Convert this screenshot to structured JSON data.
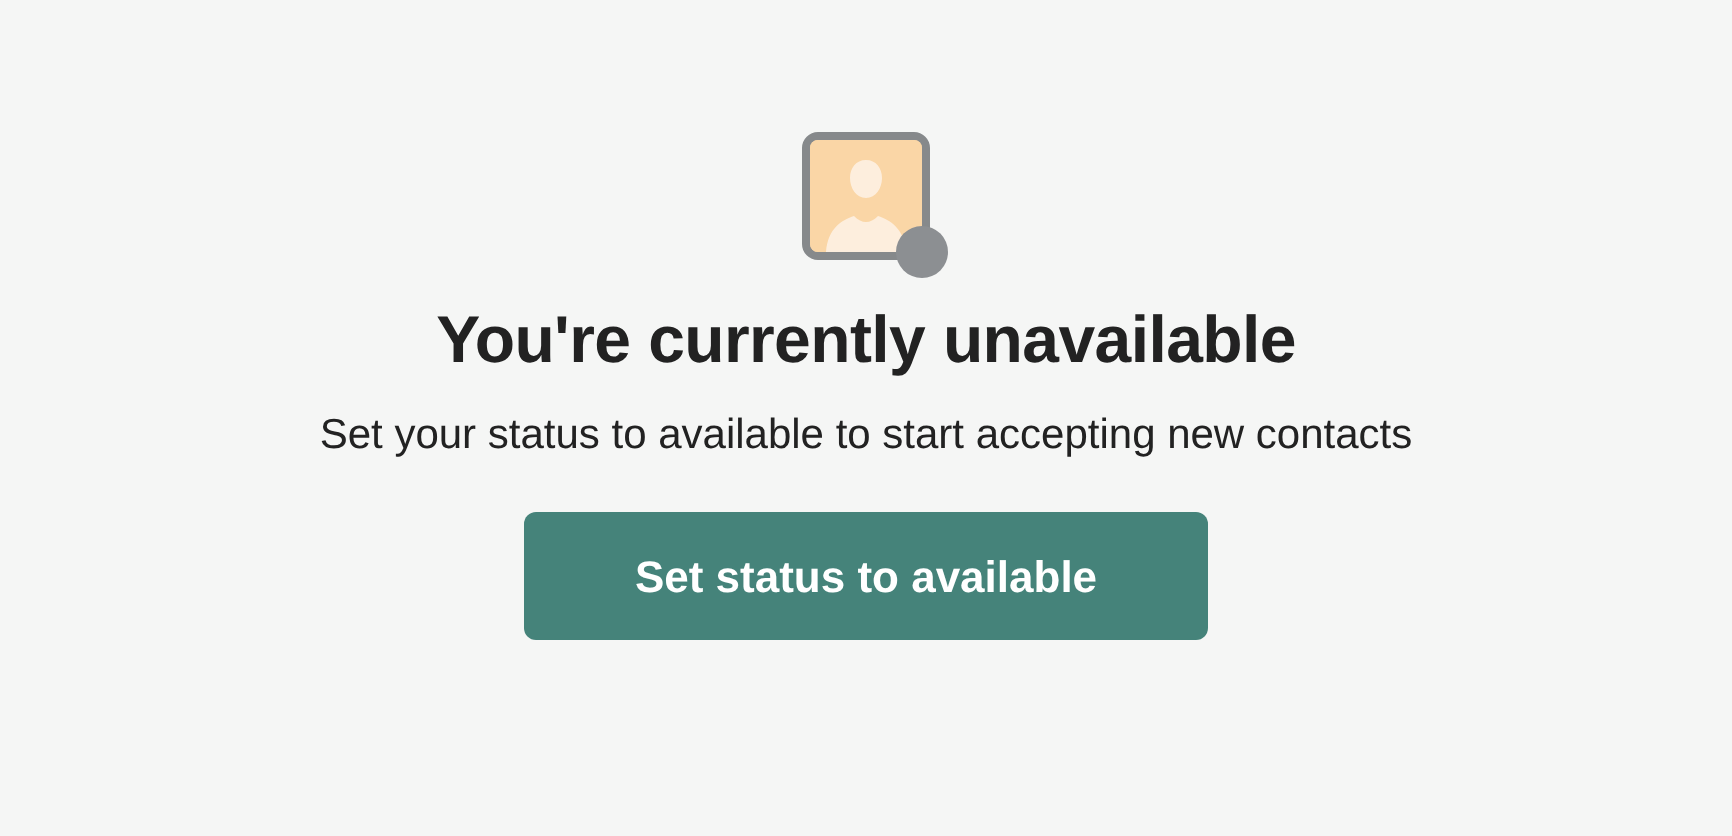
{
  "avatar": {
    "available": false
  },
  "title": "You're currently unavailable",
  "message": "Set your status to available to start accepting new contacts",
  "button": "Set status to available"
}
